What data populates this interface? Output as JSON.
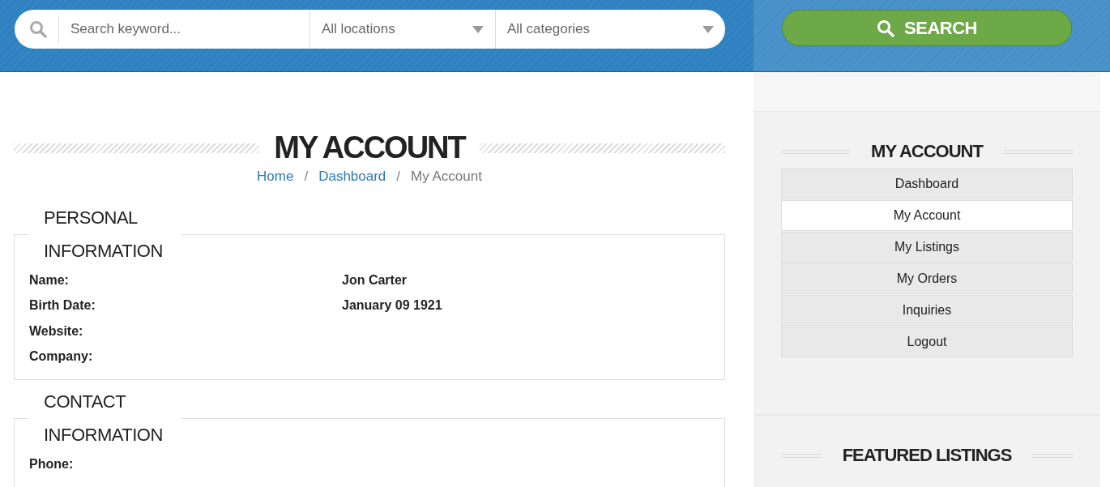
{
  "search_bar": {
    "placeholder": "Search keyword...",
    "location": "All locations",
    "category": "All categories",
    "button": "SEARCH"
  },
  "page": {
    "title": "MY ACCOUNT",
    "separator": "/",
    "breadcrumb": [
      {
        "label": "Home",
        "link": true
      },
      {
        "label": "Dashboard",
        "link": true
      },
      {
        "label": "My Account",
        "link": false
      }
    ]
  },
  "sections": [
    {
      "title": "PERSONAL INFORMATION",
      "fields": [
        {
          "label": "Name:",
          "value": "Jon Carter"
        },
        {
          "label": "Birth Date:",
          "value": "January 09 1921"
        },
        {
          "label": "Website:"
        },
        {
          "label": "Company:"
        }
      ]
    },
    {
      "title": "CONTACT INFORMATION",
      "fields": [
        {
          "label": "Phone:"
        }
      ]
    }
  ],
  "sidebar": {
    "title": "MY ACCOUNT",
    "items": [
      {
        "label": "Dashboard",
        "selected": false
      },
      {
        "label": "My Account",
        "selected": true
      },
      {
        "label": "My Listings",
        "selected": false
      },
      {
        "label": "My Orders",
        "selected": false
      },
      {
        "label": "Inquiries",
        "selected": false
      },
      {
        "label": "Logout",
        "selected": false
      }
    ],
    "featured_title": "FEATURED LISTINGS"
  }
}
